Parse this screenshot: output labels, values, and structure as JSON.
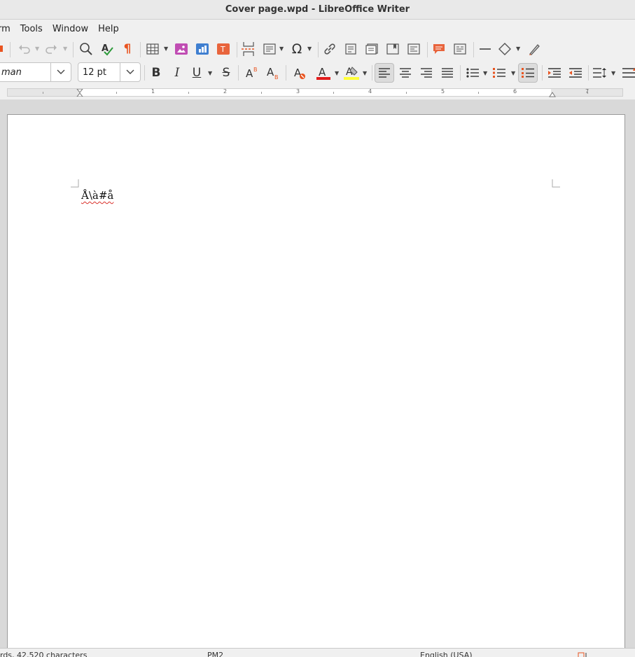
{
  "window": {
    "title": "Cover page.wpd - LibreOffice Writer"
  },
  "menubar": {
    "items": [
      "rm",
      "Tools",
      "Window",
      "Help"
    ]
  },
  "toolbar": {
    "font_name": "man",
    "font_size": "12 pt"
  },
  "ruler": {
    "numbers": [
      "1",
      "2",
      "3",
      "4",
      "5",
      "6",
      "7"
    ]
  },
  "document": {
    "text": "Å\\à#å"
  },
  "statusbar": {
    "word_count": "rds, 42,520 characters",
    "page_style": "PM2",
    "language": "English (USA)"
  },
  "colors": {
    "font_color": "#e21c1c",
    "highlight_color": "#ffff38",
    "accent": "#e95420"
  }
}
